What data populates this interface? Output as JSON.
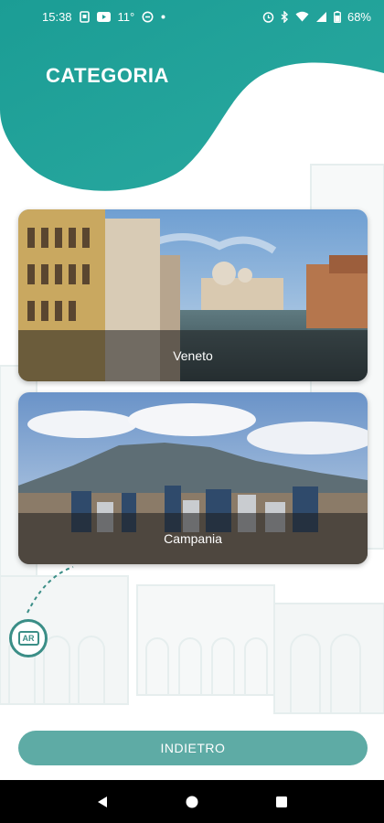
{
  "status_bar": {
    "time": "15:38",
    "temperature": "11°",
    "battery": "68%",
    "icons_left": [
      "notification-icon",
      "youtube-icon",
      "weather-icon",
      "sync-icon",
      "dot-icon"
    ],
    "icons_right": [
      "alarm-icon",
      "bluetooth-icon",
      "wifi-icon",
      "signal-icon",
      "battery-icon"
    ]
  },
  "header": {
    "title": "CATEGORIA",
    "color": "#1a9a93"
  },
  "categories": [
    {
      "label": "Veneto"
    },
    {
      "label": "Campania"
    }
  ],
  "ar_badge": {
    "label": "AR"
  },
  "footer": {
    "back_label": "INDIETRO",
    "color": "#5eaba5"
  },
  "navigation": {
    "buttons": [
      "back-icon",
      "home-icon",
      "recents-icon"
    ]
  }
}
